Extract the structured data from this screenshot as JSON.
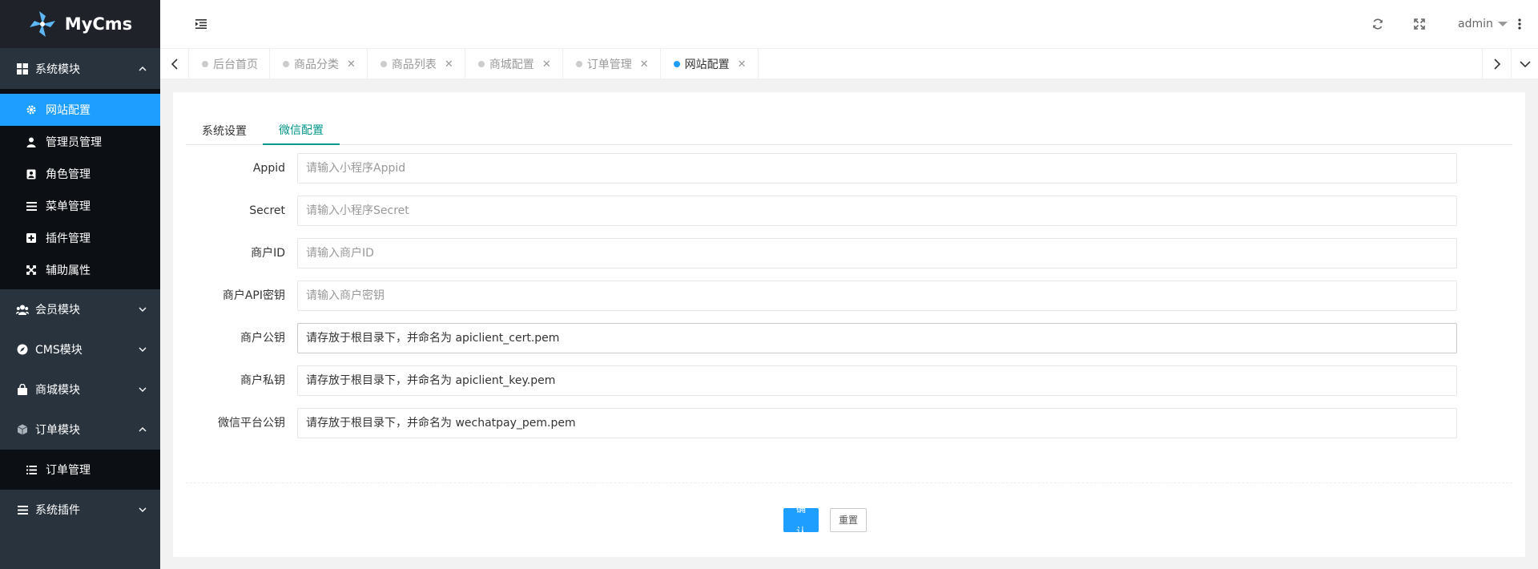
{
  "app": {
    "logo_text": "MyCms"
  },
  "sidebar": {
    "groups": [
      {
        "label": "系统模块",
        "icon": "windows-icon",
        "expanded": true,
        "items": [
          {
            "label": "网站配置",
            "icon": "gear-icon",
            "active": true
          },
          {
            "label": "管理员管理",
            "icon": "user-icon"
          },
          {
            "label": "角色管理",
            "icon": "role-icon"
          },
          {
            "label": "菜单管理",
            "icon": "menu-icon"
          },
          {
            "label": "插件管理",
            "icon": "plus-square-icon"
          },
          {
            "label": "辅助属性",
            "icon": "expand-icon"
          }
        ]
      },
      {
        "label": "会员模块",
        "icon": "users-icon",
        "expanded": false
      },
      {
        "label": "CMS模块",
        "icon": "compass-icon",
        "expanded": false
      },
      {
        "label": "商城模块",
        "icon": "shopping-bag-icon",
        "expanded": false
      },
      {
        "label": "订单模块",
        "icon": "cube-icon",
        "expanded": true,
        "items": [
          {
            "label": "订单管理",
            "icon": "list-icon"
          }
        ]
      },
      {
        "label": "系统插件",
        "icon": "bars-icon",
        "expanded": false
      }
    ]
  },
  "header": {
    "user": "admin"
  },
  "tabs": [
    {
      "label": "后台首页",
      "closable": false
    },
    {
      "label": "商品分类",
      "closable": true
    },
    {
      "label": "商品列表",
      "closable": true
    },
    {
      "label": "商城配置",
      "closable": true
    },
    {
      "label": "订单管理",
      "closable": true
    },
    {
      "label": "网站配置",
      "closable": true,
      "active": true
    }
  ],
  "card_tabs": [
    {
      "label": "系统设置"
    },
    {
      "label": "微信配置",
      "active": true
    }
  ],
  "form": {
    "fields": [
      {
        "label": "Appid",
        "value": "",
        "placeholder": "请输入小程序Appid"
      },
      {
        "label": "Secret",
        "value": "",
        "placeholder": "请输入小程序Secret"
      },
      {
        "label": "商户ID",
        "value": "",
        "placeholder": "请输入商户ID"
      },
      {
        "label": "商户API密钥",
        "value": "",
        "placeholder": "请输入商户密钥"
      },
      {
        "label": "商户公钥",
        "value": "请存放于根目录下，并命名为 apiclient_cert.pem",
        "placeholder": ""
      },
      {
        "label": "商户私钥",
        "value": "请存放于根目录下，并命名为 apiclient_key.pem",
        "placeholder": ""
      },
      {
        "label": "微信平台公钥",
        "value": "请存放于根目录下，并命名为 wechatpay_pem.pem",
        "placeholder": ""
      }
    ],
    "confirm_label": "确认",
    "reset_label": "重置"
  },
  "colors": {
    "accent": "#1e9fff",
    "sidebar_bg": "#28333e",
    "active_tab": "#009688"
  }
}
